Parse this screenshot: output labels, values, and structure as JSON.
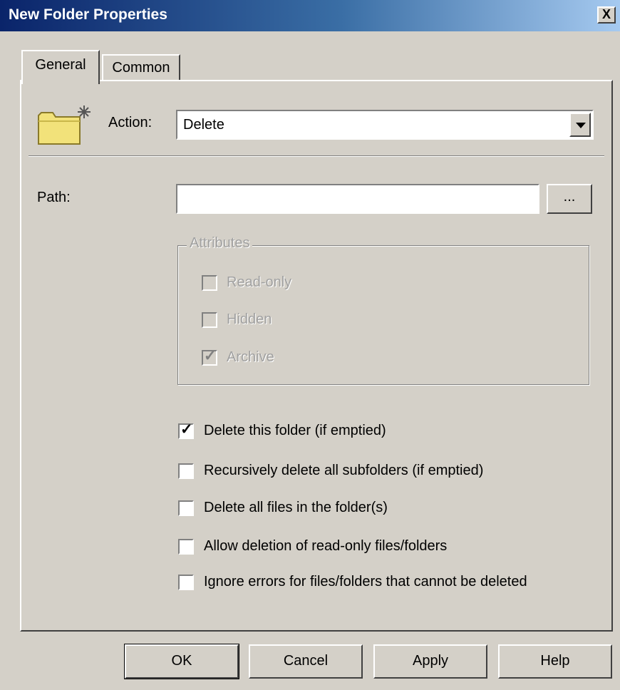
{
  "window": {
    "title": "New Folder Properties",
    "close_label": "X"
  },
  "tabs": [
    {
      "label": "General",
      "active": true
    },
    {
      "label": "Common",
      "active": false
    }
  ],
  "action": {
    "label": "Action:",
    "value": "Delete"
  },
  "path": {
    "label": "Path:",
    "value": "",
    "browse_label": "..."
  },
  "attributes": {
    "label": "Attributes",
    "items": [
      {
        "label": "Read-only",
        "checked": false,
        "disabled": true
      },
      {
        "label": "Hidden",
        "checked": false,
        "disabled": true
      },
      {
        "label": "Archive",
        "checked": true,
        "disabled": true
      }
    ]
  },
  "options": [
    {
      "label": "Delete this folder (if emptied)",
      "checked": true
    },
    {
      "label": "Recursively delete all subfolders (if emptied)",
      "checked": false
    },
    {
      "label": "Delete all files in the folder(s)",
      "checked": false
    },
    {
      "label": "Allow deletion of read-only files/folders",
      "checked": false
    },
    {
      "label": "Ignore errors for files/folders that cannot be deleted",
      "checked": false
    }
  ],
  "buttons": {
    "ok": "OK",
    "cancel": "Cancel",
    "apply": "Apply",
    "help": "Help"
  },
  "icons": {
    "folder": "folder-new-icon",
    "dropdown": "chevron-down-icon"
  },
  "colors": {
    "titlebar_start": "#0a246a",
    "titlebar_end": "#a6caf0",
    "face": "#d4d0c8"
  }
}
